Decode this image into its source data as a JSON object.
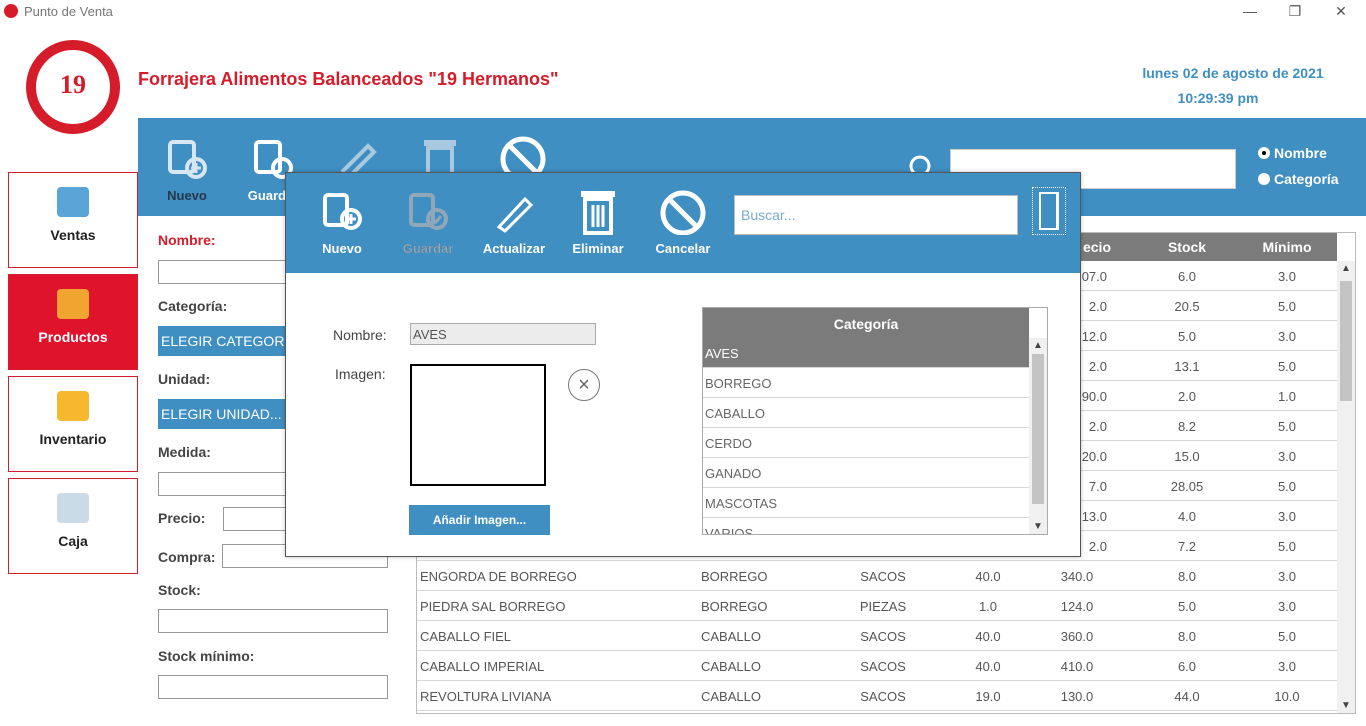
{
  "window": {
    "title": "Punto de Venta",
    "min": "—",
    "max": "❐",
    "close": "✕"
  },
  "header": {
    "logo_text": "19",
    "company": "Forrajera Alimentos Balanceados \"19 Hermanos\"",
    "date": "lunes 02 de agosto de 2021",
    "time": "10:29:39 pm"
  },
  "toolbar": {
    "nuevo": "Nuevo",
    "guardar": "Guardar",
    "search_placeholder": "Buscar...",
    "radio_nombre": "Nombre",
    "radio_categoria": "Categoría"
  },
  "sidebar": {
    "items": [
      {
        "label": "Ventas"
      },
      {
        "label": "Productos"
      },
      {
        "label": "Inventario"
      },
      {
        "label": "Caja"
      }
    ]
  },
  "form": {
    "nombre": "Nombre:",
    "categoria": "Categoría:",
    "categoria_select": "ELEGIR CATEGORÍA",
    "unidad": "Unidad:",
    "unidad_select": "ELEGIR UNIDAD...",
    "medida": "Medida:",
    "precio": "Precio:",
    "compra": "Compra:",
    "stock": "Stock:",
    "stock_minimo": "Stock mínimo:"
  },
  "table": {
    "headers": [
      "ecio",
      "Stock",
      "Mínimo"
    ],
    "partial_rows": [
      {
        "precio": "07.0",
        "stock": "6.0",
        "minimo": "3.0"
      },
      {
        "precio": "2.0",
        "stock": "20.5",
        "minimo": "5.0"
      },
      {
        "precio": "12.0",
        "stock": "5.0",
        "minimo": "3.0"
      },
      {
        "precio": "2.0",
        "stock": "13.1",
        "minimo": "5.0"
      },
      {
        "precio": "90.0",
        "stock": "2.0",
        "minimo": "1.0"
      },
      {
        "precio": "2.0",
        "stock": "8.2",
        "minimo": "5.0"
      },
      {
        "precio": "20.0",
        "stock": "15.0",
        "minimo": "3.0"
      },
      {
        "precio": "7.0",
        "stock": "28.05",
        "minimo": "5.0"
      },
      {
        "precio": "13.0",
        "stock": "4.0",
        "minimo": "3.0"
      },
      {
        "precio": "2.0",
        "stock": "7.2",
        "minimo": "5.0"
      }
    ],
    "rows": [
      {
        "nombre": "ENGORDA DE BORREGO",
        "categoria": "BORREGO",
        "unidad": "SACOS",
        "medida": "40.0",
        "precio": "340.0",
        "stock": "8.0",
        "minimo": "3.0"
      },
      {
        "nombre": "PIEDRA SAL BORREGO",
        "categoria": "BORREGO",
        "unidad": "PIEZAS",
        "medida": "1.0",
        "precio": "124.0",
        "stock": "5.0",
        "minimo": "3.0"
      },
      {
        "nombre": "CABALLO FIEL",
        "categoria": "CABALLO",
        "unidad": "SACOS",
        "medida": "40.0",
        "precio": "360.0",
        "stock": "8.0",
        "minimo": "5.0"
      },
      {
        "nombre": "CABALLO IMPERIAL",
        "categoria": "CABALLO",
        "unidad": "SACOS",
        "medida": "40.0",
        "precio": "410.0",
        "stock": "6.0",
        "minimo": "3.0"
      },
      {
        "nombre": "REVOLTURA LIVIANA",
        "categoria": "CABALLO",
        "unidad": "SACOS",
        "medida": "19.0",
        "precio": "130.0",
        "stock": "44.0",
        "minimo": "10.0"
      }
    ]
  },
  "modal": {
    "nuevo": "Nuevo",
    "guardar": "Guardar",
    "actualizar": "Actualizar",
    "eliminar": "Eliminar",
    "cancelar": "Cancelar",
    "search_placeholder": "Buscar...",
    "nombre_label": "Nombre:",
    "nombre_value": "AVES",
    "imagen_label": "Imagen:",
    "add_image": "Añadir Imagen...",
    "list_header": "Categoría",
    "categories": [
      "AVES",
      "BORREGO",
      "CABALLO",
      "CERDO",
      "GANADO",
      "MASCOTAS",
      "VARIOS"
    ]
  },
  "colors": {
    "brand_red": "#d51c2a",
    "brand_blue": "#3f8fc2",
    "header_gray": "#7b7b7b"
  }
}
